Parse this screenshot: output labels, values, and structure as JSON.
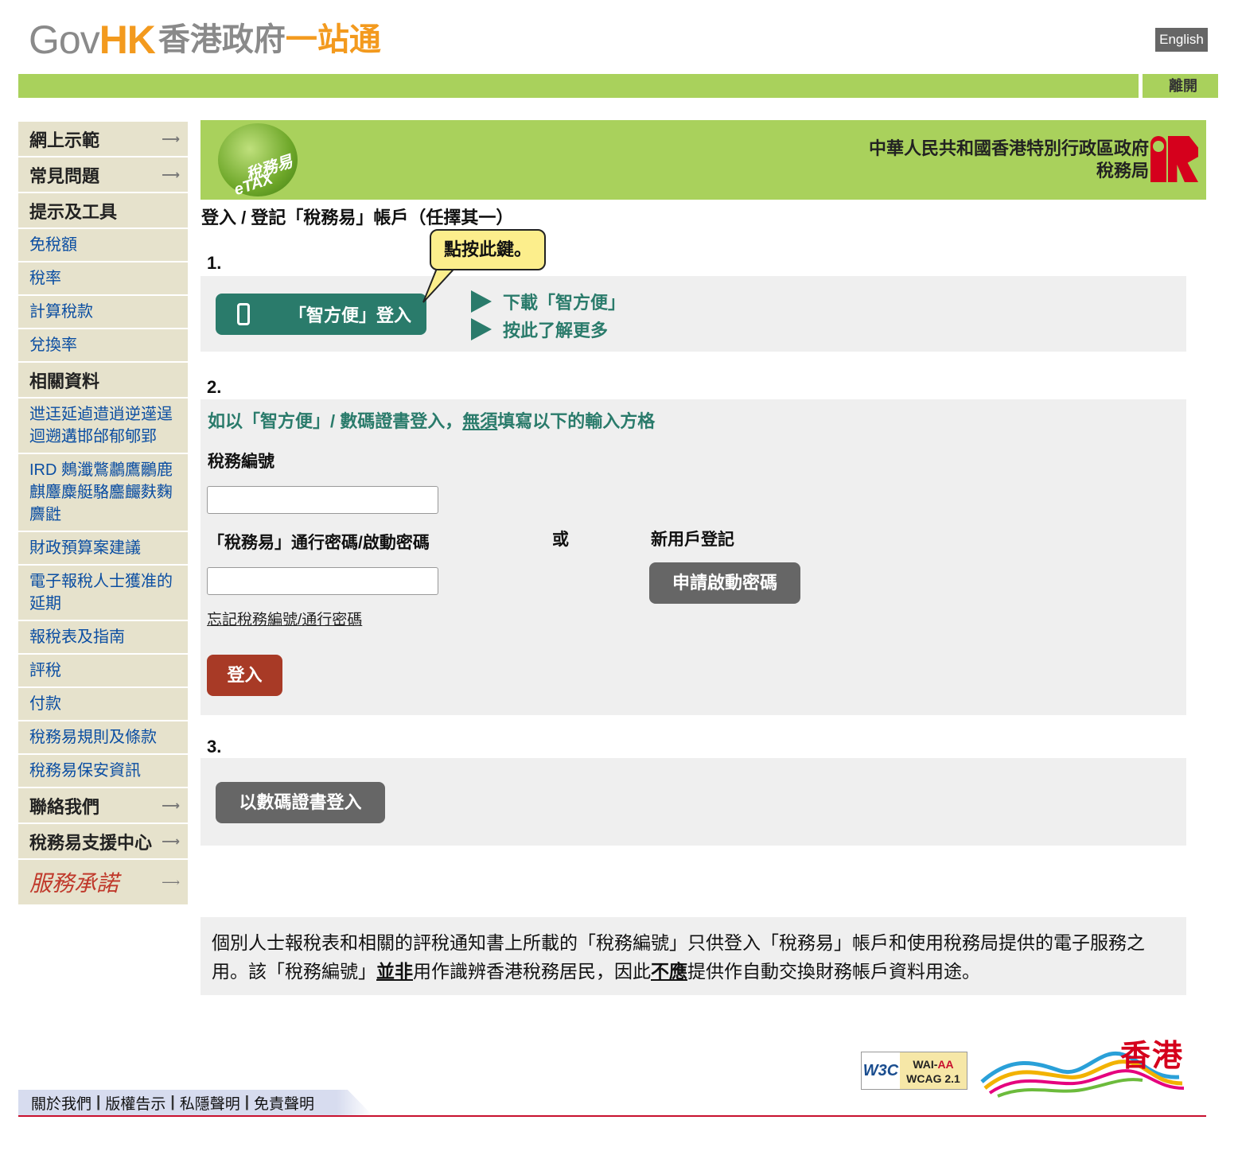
{
  "header": {
    "logo_gov": "Gov",
    "logo_hk": "HK",
    "logo_cn_grey": "香港政府",
    "logo_cn_orange": "一站通",
    "language_button": "English",
    "logout": "離開"
  },
  "sidebar": {
    "items": [
      {
        "label": "網上示範",
        "type": "head",
        "expand": true
      },
      {
        "label": "常見問題",
        "type": "head",
        "expand": true
      },
      {
        "label": "提示及工具",
        "type": "head",
        "expand": false
      },
      {
        "label": "免稅額",
        "type": "link"
      },
      {
        "label": "稅率",
        "type": "link"
      },
      {
        "label": "計算稅款",
        "type": "link"
      },
      {
        "label": "兌換率",
        "type": "link"
      },
      {
        "label": "相關資料",
        "type": "head",
        "expand": false
      },
      {
        "label": "迣迋延逌逪逍逆遳逞迴遡遘邯邰郁郇郢",
        "type": "link"
      },
      {
        "label": "IRD 鷞瀸鷩鷫鷹鸍鹿麒麞麋艇駱麢麣麩麴麡鼪",
        "type": "link"
      },
      {
        "label": "財政預算案建議",
        "type": "link"
      },
      {
        "label": "電子報稅人士獲准的延期",
        "type": "link"
      },
      {
        "label": "報稅表及指南",
        "type": "link"
      },
      {
        "label": "評稅",
        "type": "link"
      },
      {
        "label": "付款",
        "type": "link"
      },
      {
        "label": "稅務易規則及條款",
        "type": "link"
      },
      {
        "label": "稅務易保安資訊",
        "type": "link"
      },
      {
        "label": "聯絡我們",
        "type": "head",
        "expand": true
      },
      {
        "label": "稅務易支援中心",
        "type": "head",
        "expand": true
      }
    ],
    "pledge": "服務承諾",
    "expand_glyph": "⟶"
  },
  "banner": {
    "badge_cn": "稅務易",
    "badge_en": "eTAX",
    "gov_line1": "中華人民共和國香港特別行政區政府",
    "gov_line2": "稅務局"
  },
  "main": {
    "title": "登入 / 登記「稅務易」帳戶（任擇其一）",
    "tooltip": "點按此鍵。",
    "step1": {
      "num": "1.",
      "iamsmart_button": "「智方便」登入",
      "download_link": "下載「智方便」",
      "learn_more_link": "按此了解更多"
    },
    "step2": {
      "num": "2.",
      "note_before": "如以「智方便」/ 數碼證書登入，",
      "note_underlined": "無須",
      "note_after": "填寫以下的輸入方格",
      "tax_no_label": "稅務編號",
      "password_label": "「稅務易」通行密碼/啟動密碼",
      "or_label": "或",
      "new_user_label": "新用戶登記",
      "activate_button": "申請啟動密碼",
      "forgot_link": "忘記稅務編號/通行密碼",
      "login_button": "登入"
    },
    "step3": {
      "num": "3.",
      "cert_button": "以數碼證書登入"
    }
  },
  "notice": {
    "p1": "個別人士報稅表和相關的評稅通知書上所載的「稅務編號」只供登入「稅務易」帳戶和使用稅務局提供的電子服務之用。該「稅務編號」",
    "b1": "並非",
    "p2": "用作識辨香港稅務居民，因此",
    "b2": "不應",
    "p3": "提供作自動交換財務帳戶資料用途。"
  },
  "footer": {
    "links": [
      "關於我們",
      "版權告示",
      "私隱聲明",
      "免責聲明"
    ],
    "w3c": "W3C",
    "wai_line1_a": "WAI-",
    "wai_line1_b": "AA",
    "wai_line2": "WCAG 2.1",
    "brand_hk": "香港"
  },
  "colors": {
    "green_bar": "#a9d15c",
    "teal": "#2a7b6b",
    "login_red": "#a83a26",
    "grey_button": "#666666",
    "link_blue": "#0b4ea2"
  }
}
